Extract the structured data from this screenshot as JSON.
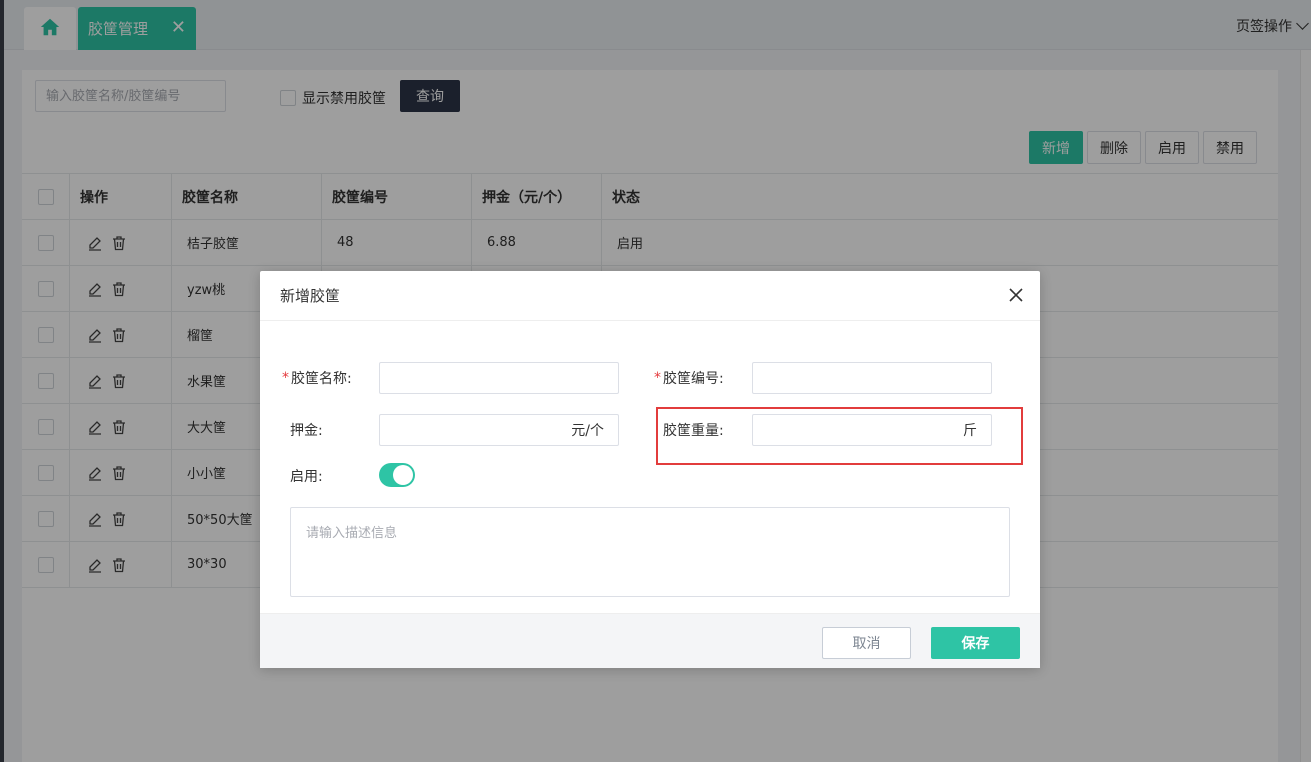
{
  "tabs": {
    "home_icon": "home-icon",
    "active_label": "胶筐管理",
    "close_glyph": "✕",
    "ops_label": "页签操作"
  },
  "toolbar": {
    "search_placeholder": "输入胶筐名称/胶筐编号",
    "show_disabled_label": "显示禁用胶筐",
    "query_label": "查询",
    "add_label": "新增",
    "delete_label": "删除",
    "enable_label": "启用",
    "disable_label": "禁用"
  },
  "table": {
    "headers": [
      "操作",
      "胶筐名称",
      "胶筐编号",
      "押金（元/个）",
      "状态"
    ],
    "rows": [
      {
        "name": "桔子胶筐",
        "code": "48",
        "deposit": "6.88",
        "status": "启用"
      },
      {
        "name": "yzw桃",
        "code": "",
        "deposit": "",
        "status": ""
      },
      {
        "name": "榴筐",
        "code": "",
        "deposit": "",
        "status": ""
      },
      {
        "name": "水果筐",
        "code": "",
        "deposit": "",
        "status": ""
      },
      {
        "name": "大大筐",
        "code": "",
        "deposit": "",
        "status": ""
      },
      {
        "name": "小小筐",
        "code": "",
        "deposit": "",
        "status": ""
      },
      {
        "name": "50*50大筐",
        "code": "",
        "deposit": "",
        "status": ""
      },
      {
        "name": "30*30",
        "code": "",
        "deposit": "",
        "status": ""
      }
    ]
  },
  "dialog": {
    "title": "新增胶筐",
    "name_label": "胶筐名称:",
    "code_label": "胶筐编号:",
    "deposit_label": "押金:",
    "deposit_unit": "元/个",
    "weight_label": "胶筐重量:",
    "weight_unit": "斤",
    "enable_label": "启用:",
    "enable_on": true,
    "desc_placeholder": "请输入描述信息",
    "cancel_label": "取消",
    "save_label": "保存",
    "required_mark": "*"
  },
  "colors": {
    "accent": "#2ec4a5",
    "dark_button": "#2d3447",
    "highlight": "#e23c3c"
  }
}
